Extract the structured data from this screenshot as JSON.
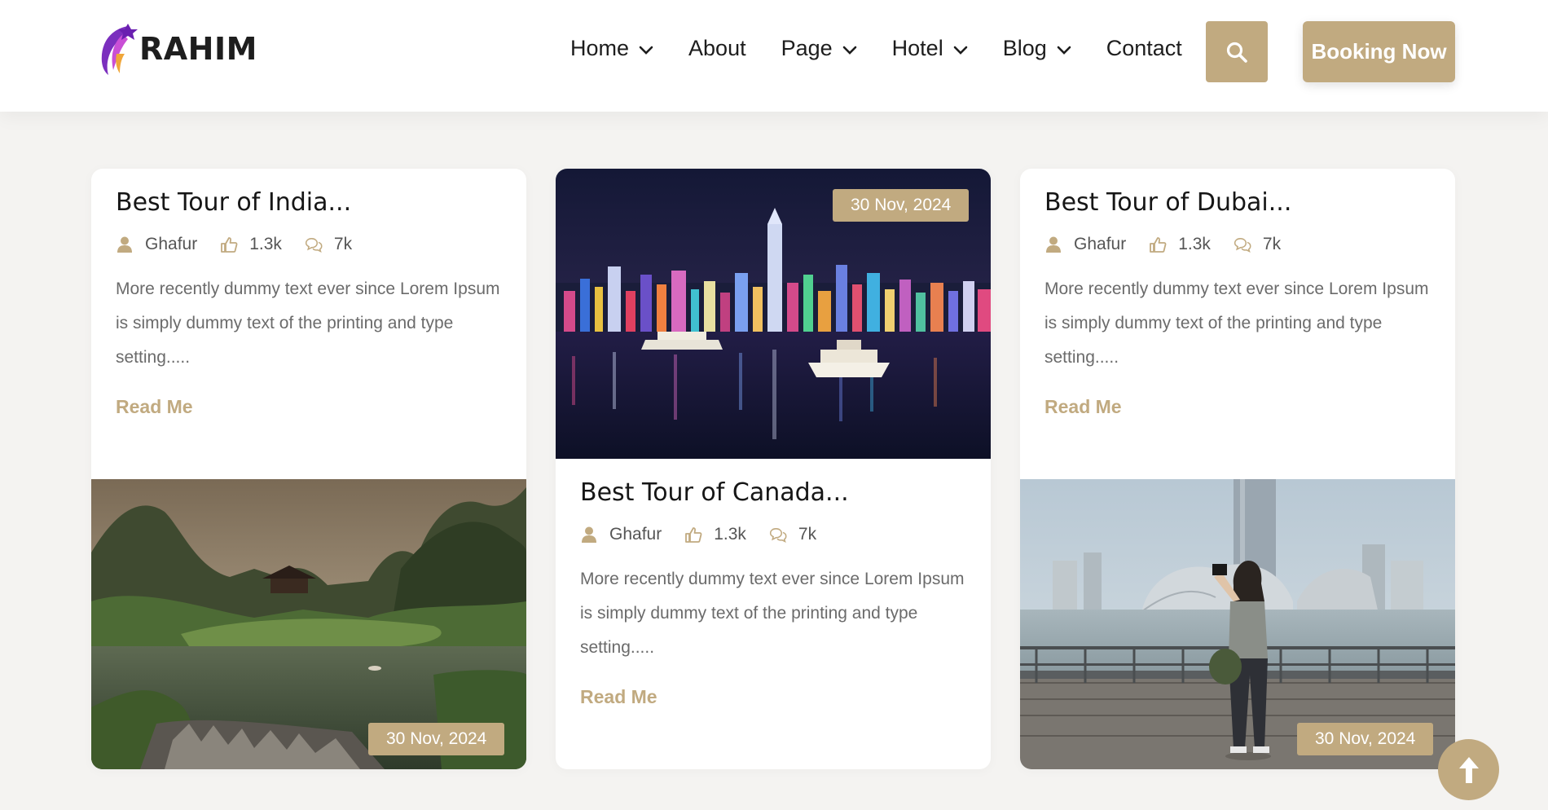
{
  "brand": {
    "name": "RAHIM"
  },
  "nav": {
    "items": [
      {
        "label": "Home",
        "dropdown": true
      },
      {
        "label": "About",
        "dropdown": false
      },
      {
        "label": "Page",
        "dropdown": true
      },
      {
        "label": "Hotel",
        "dropdown": true
      },
      {
        "label": "Blog",
        "dropdown": true
      },
      {
        "label": "Contact",
        "dropdown": false
      }
    ],
    "search_icon": "search-icon",
    "booking_label": "Booking Now"
  },
  "posts": [
    {
      "title": "Best Tour of India...",
      "author": "Ghafur",
      "likes": "1.3k",
      "comments": "7k",
      "excerpt": "More recently dummy text ever since Lorem Ipsum is simply dummy text of the printing and type setting.....",
      "read_more": "Read Me",
      "date": "30 Nov, 2024",
      "image": "mountain-lake-temple"
    },
    {
      "title": "Best Tour of Canada...",
      "author": "Ghafur",
      "likes": "1.3k",
      "comments": "7k",
      "excerpt": "More recently dummy text ever since Lorem Ipsum is simply dummy text of the printing and type setting.....",
      "read_more": "Read Me",
      "date": "30 Nov, 2024",
      "image": "city-skyline-night"
    },
    {
      "title": "Best Tour of Dubai...",
      "author": "Ghafur",
      "likes": "1.3k",
      "comments": "7k",
      "excerpt": "More recently dummy text ever since Lorem Ipsum is simply dummy text of the printing and type setting.....",
      "read_more": "Read Me",
      "date": "30 Nov, 2024",
      "image": "woman-photographing-waterfront"
    }
  ],
  "colors": {
    "accent": "#c1aa80",
    "background": "#f4f3f1",
    "card": "#ffffff",
    "heading": "#161616",
    "text": "#6b6b6b"
  },
  "scroll_top_icon": "arrow-up-icon"
}
